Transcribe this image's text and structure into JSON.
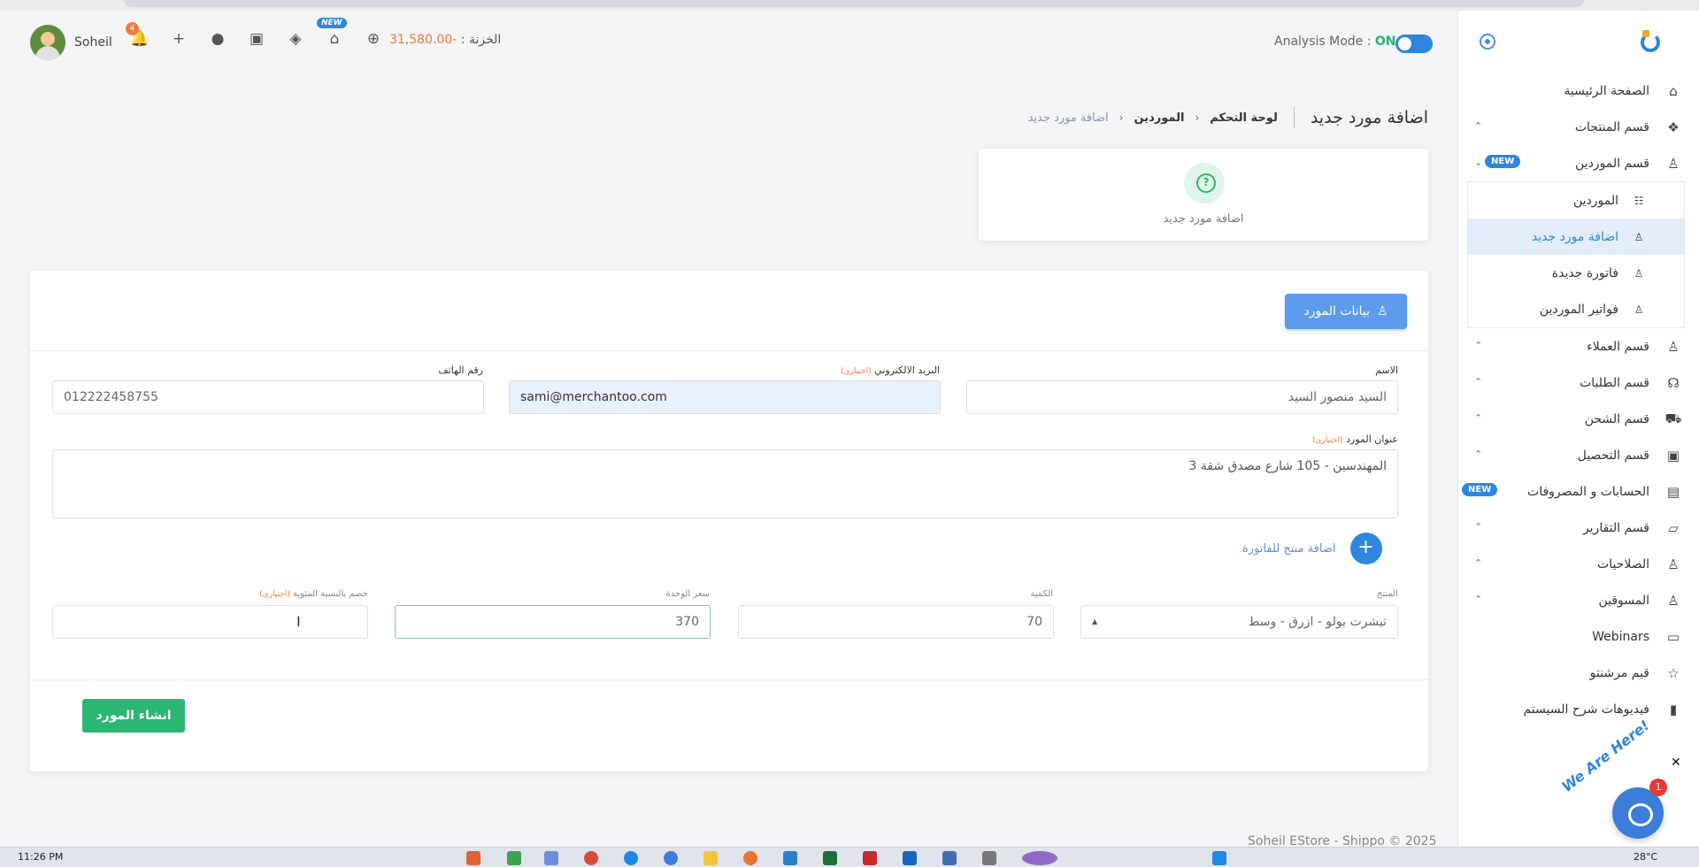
{
  "topbar": {
    "user_name": "Soheil",
    "notifications_count": "4",
    "new_badge": "NEW",
    "balance_label": "الخزنة :",
    "balance_value": "-31,580.00",
    "analysis_label": "Analysis Mode :",
    "analysis_state": "ON"
  },
  "header": {
    "title": "اضافة مورد جديد",
    "breadcrumb": [
      "لوحة التحكم",
      "الموردين",
      "اضافة مورد جديد"
    ]
  },
  "help_card": {
    "label": "اضافة مورد جديد"
  },
  "form": {
    "tab_label": "بيانات المورد",
    "name_label": "الاسم",
    "name_value": "السيد منصور السيد",
    "email_label": "البريد الالكتروني",
    "email_optional": "(اختياري)",
    "email_value": "sami@merchantoo.com",
    "phone_label": "رقم الهاتف",
    "phone_value": "012222458755",
    "address_label": "عنوان المورد",
    "address_optional": "(اختياري)",
    "address_value": "المهندسين - 105 شارع مصدق شقة 3",
    "add_product_label": "اضافة منتج للفاتورة",
    "product_label": "المنتج",
    "product_value": "تيشرت بولو - ازرق - وسط",
    "quantity_label": "الكمية",
    "quantity_value": "70",
    "unit_price_label": "سعر الوحدة",
    "unit_price_value": "370",
    "discount_label": "خصم بالنسبة المئوية",
    "discount_optional": "(اختياري)",
    "submit_label": "انشاء المورد"
  },
  "sidebar": {
    "items": [
      {
        "label": "الصفحة الرئيسية"
      },
      {
        "label": "قسم المنتجات"
      },
      {
        "label": "قسم الموردين",
        "badge": "NEW"
      },
      {
        "label": "الموردين"
      },
      {
        "label": "اضافة مورد جديد"
      },
      {
        "label": "فاتورة جديدة"
      },
      {
        "label": "فواتير الموردين"
      },
      {
        "label": "قسم العملاء"
      },
      {
        "label": "قسم الطلبات"
      },
      {
        "label": "قسم الشحن"
      },
      {
        "label": "قسم التحصيل"
      },
      {
        "label": "الحسابات و المصروفات",
        "badge": "NEW"
      },
      {
        "label": "قسم التقارير"
      },
      {
        "label": "الصلاحيات"
      },
      {
        "label": "المسوقين"
      },
      {
        "label": "Webinars"
      },
      {
        "label": "قيم مرشنتو"
      },
      {
        "label": "فيديوهات شرح السيستم"
      }
    ]
  },
  "footer": {
    "copyright": "Soheil EStore - Shippo © 2025"
  },
  "chat": {
    "text": "We Are Here!",
    "count": "1"
  },
  "taskbar": {
    "time": "11:26 PM",
    "temp": "28°C"
  },
  "colors": {
    "primary": "#2e86de",
    "success": "#2bb673",
    "warning": "#f27a3b"
  }
}
